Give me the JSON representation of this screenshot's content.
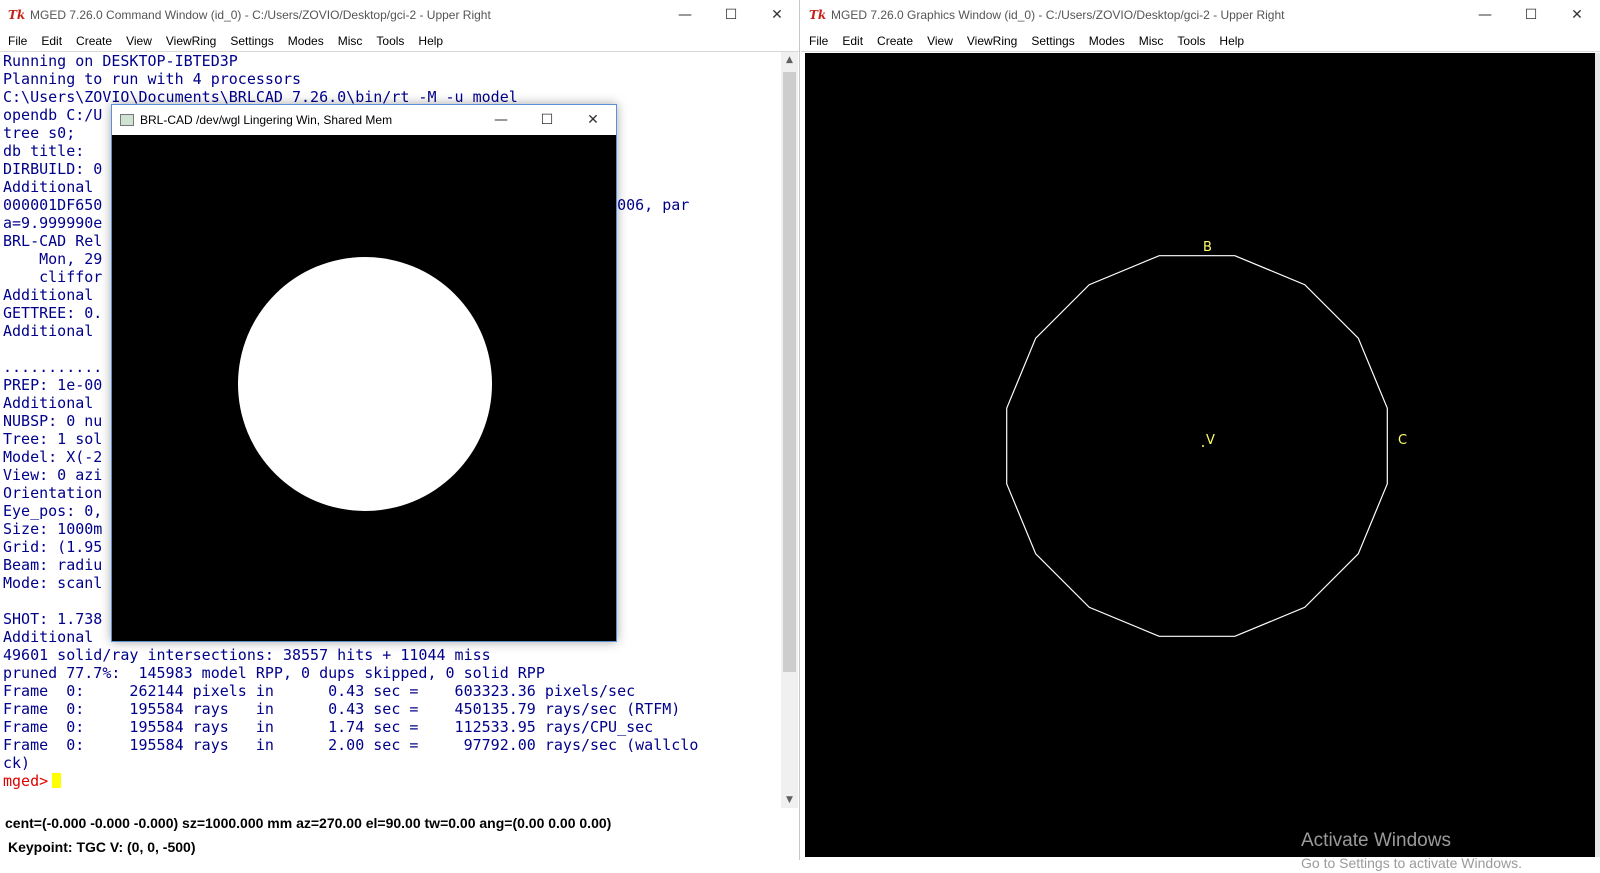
{
  "command_window": {
    "title": "MGED 7.26.0 Command Window (id_0) - C:/Users/ZOVIO/Desktop/gci-2 - Upper Right",
    "app_icon": "Tk",
    "controls": {
      "minimize": "—",
      "maximize": "☐",
      "close": "✕"
    },
    "menu": [
      "File",
      "Edit",
      "Create",
      "View",
      "ViewRing",
      "Settings",
      "Modes",
      "Misc",
      "Tools",
      "Help"
    ],
    "console_lines": [
      "Running on DESKTOP-IBTED3P",
      "Planning to run with 4 processors",
      "C:\\Users\\ZOVIO\\Documents\\BRLCAD 7.26.0\\bin/rt -M -u model",
      "opendb C:/U",
      "tree s0;",
      "db title:",
      "DIRBUILD: 0",
      "Additional",
      "000001DF650                                                 000000e-006, par",
      "a=9.999990e",
      "BRL-CAD Rel",
      "    Mon, 29                                               ion 0",
      "    cliffor",
      "Additional",
      "GETTREE: 0.",
      "Additional",
      "",
      "...........",
      "PREP: 1e-00",
      "Additional",
      "NUBSP: 0 nu",
      "Tree: 1 sol",
      "Model: X(-2",
      "View: 0 azi",
      "Orientation",
      "Eye_pos: 0,",
      "Size: 1000m",
      "Grid: (1.95",
      "Beam: radiu",
      "Mode: scanl",
      "",
      "SHOT: 1.738",
      "Additional",
      "49601 solid/ray intersections: 38557 hits + 11044 miss",
      "pruned 77.7%:  145983 model RPP, 0 dups skipped, 0 solid RPP",
      "Frame  0:     262144 pixels in      0.43 sec =    603323.36 pixels/sec",
      "Frame  0:     195584 rays   in      0.43 sec =    450135.79 rays/sec (RTFM)",
      "Frame  0:     195584 rays   in      1.74 sec =    112533.95 rays/CPU_sec",
      "Frame  0:     195584 rays   in      2.00 sec =     97792.00 rays/sec (wallclo",
      "ck)",
      ""
    ],
    "prompt": "mged>",
    "status_line_1": "cent=(-0.000 -0.000 -0.000) sz=1000.000  mm  az=270.00  el=90.00  tw=0.00  ang=(0.00 0.00 0.00)",
    "status_line_2": "Keypoint: TGC V: (0, 0, -500)"
  },
  "raytrace_window": {
    "title": "BRL-CAD /dev/wgl Lingering Win, Shared Mem",
    "controls": {
      "minimize": "—",
      "maximize": "☐",
      "close": "✕"
    },
    "render_background": "#000000",
    "render_object_color": "#ffffff"
  },
  "graphics_window": {
    "title": "MGED 7.26.0 Graphics Window (id_0) - C:/Users/ZOVIO/Desktop/gci-2 - Upper Right",
    "app_icon": "Tk",
    "controls": {
      "minimize": "—",
      "maximize": "☐",
      "close": "✕"
    },
    "menu": [
      "File",
      "Edit",
      "Create",
      "View",
      "ViewRing",
      "Settings",
      "Modes",
      "Misc",
      "Tools",
      "Help"
    ],
    "labels": {
      "top": "B",
      "center": "V",
      "right": "C"
    },
    "wireframe_color": "#ffffff",
    "label_color": "#ffff66",
    "background": "#000000",
    "polygon_sides": 16
  },
  "activation_notice": {
    "title": "Activate Windows",
    "subtitle": "Go to Settings to activate Windows."
  }
}
